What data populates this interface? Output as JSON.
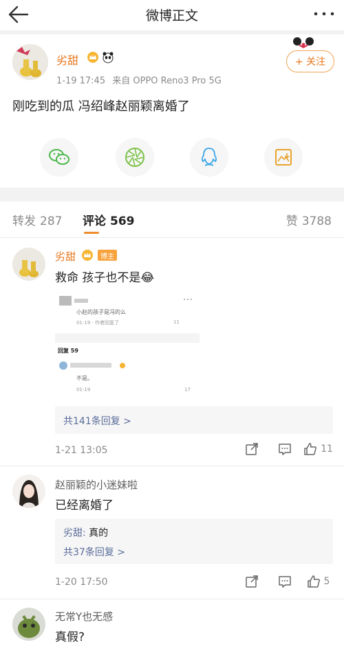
{
  "header": {
    "title": "微博正文"
  },
  "post": {
    "username": "劣甜",
    "time": "1-19 17:45",
    "source": "来自 OPPO Reno3 Pro 5G",
    "follow_label": "+ 关注",
    "text": "刚吃到的瓜 冯绍峰赵丽颖离婚了"
  },
  "tabs": {
    "repost_label": "转发",
    "repost_count": "287",
    "comment_label": "评论",
    "comment_count": "569",
    "like_label": "赞",
    "like_count": "3788"
  },
  "comments": [
    {
      "username": "劣甜",
      "badge": "博主",
      "text": "救命 孩子也不是😂",
      "embedded": {
        "reply_text": "小赵的孩子是冯的么",
        "meta": "01-19 · 作者回复了",
        "like_count": "11",
        "reply_header": "回复 59",
        "reply2_text": "不是。",
        "meta2": "01-19",
        "like_count2": "17"
      },
      "reply_link": "共141条回复 >",
      "time": "1-21 13:05",
      "likes": "11"
    },
    {
      "username": "赵丽颖的小迷妹啦",
      "text": "已经离婚了",
      "reply_author": "劣甜:",
      "reply_text": "真的",
      "reply_link": "共37条回复 >",
      "time": "1-20 17:50",
      "likes": "5"
    },
    {
      "username": "无常Y也无感",
      "text": "真假?"
    }
  ]
}
